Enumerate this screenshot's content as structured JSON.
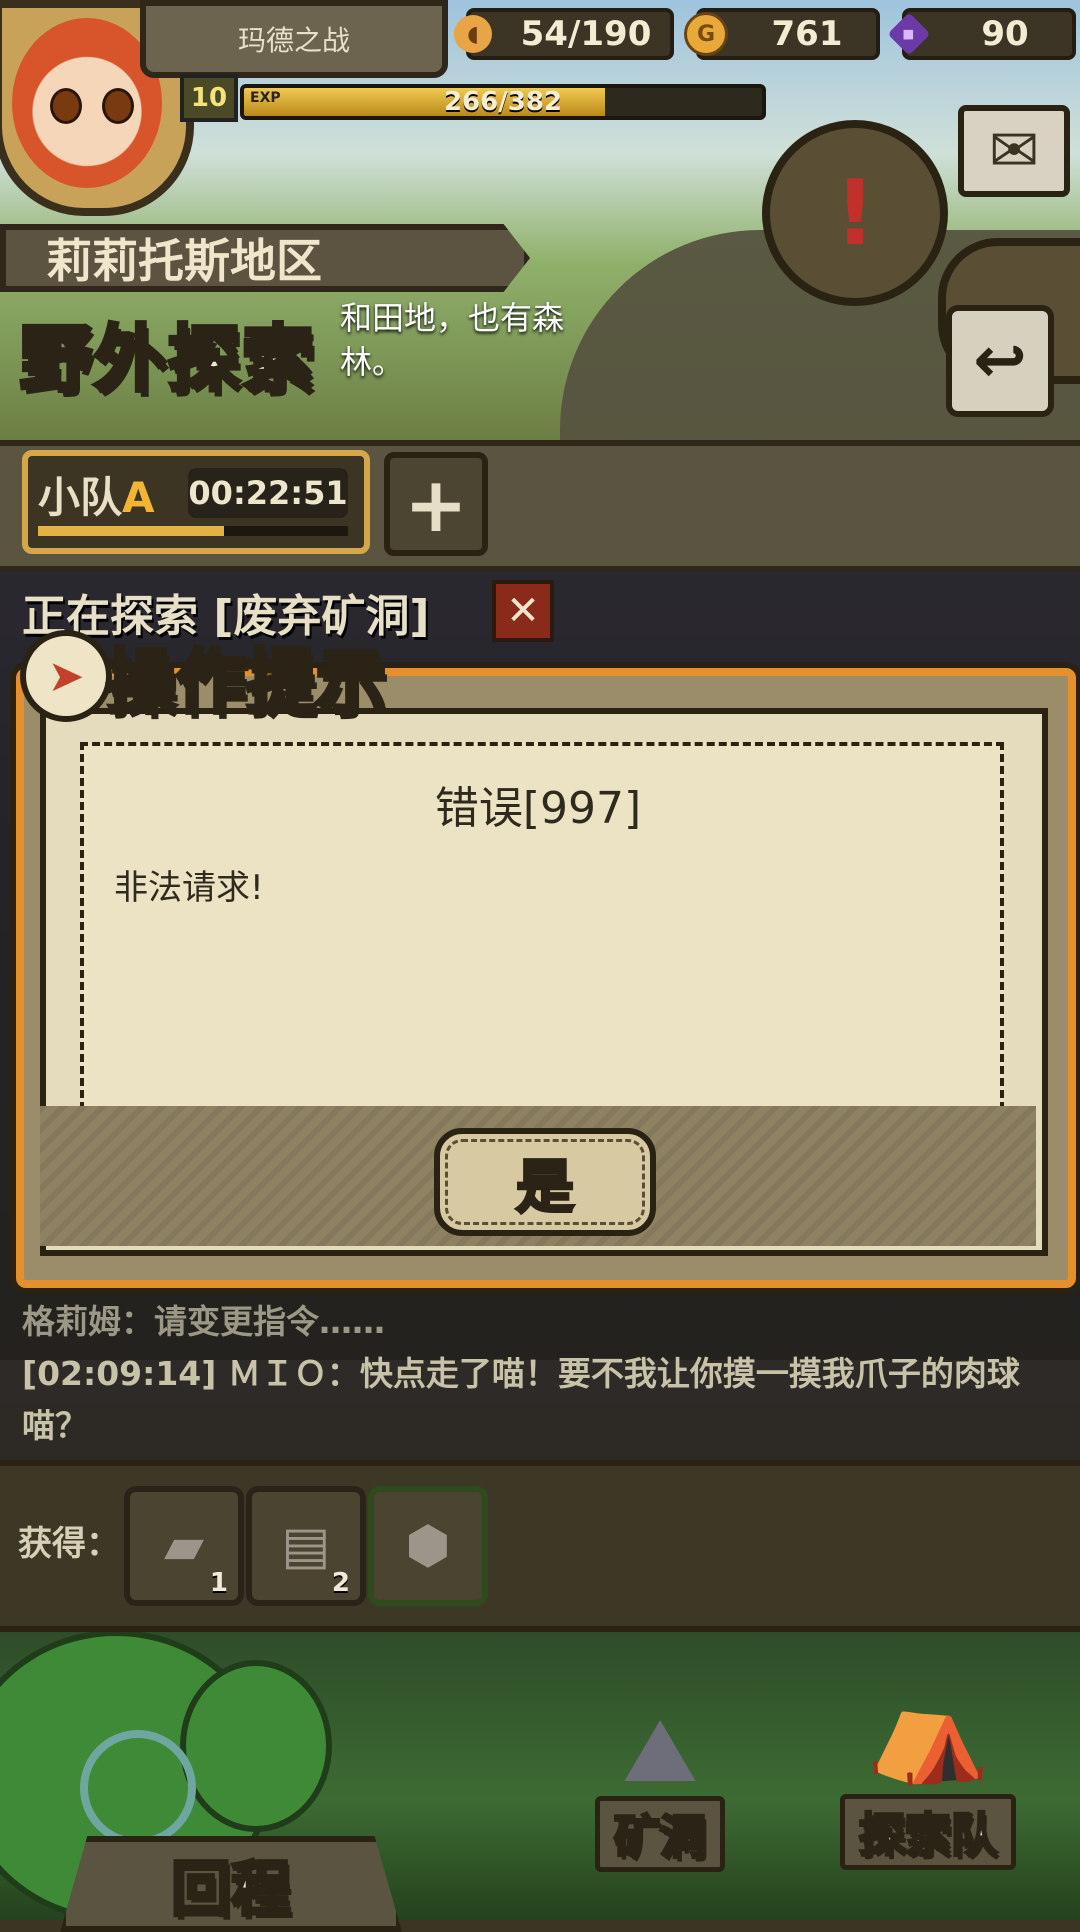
{
  "header": {
    "player_name": "玛德之战",
    "level": "10",
    "exp_tag": "EXP",
    "exp_text": "266/382",
    "exp_progress": 0.696,
    "resources": [
      {
        "name": "bread",
        "icon": "bread-icon",
        "value": "54/190"
      },
      {
        "name": "gold",
        "icon": "gold-coin-icon",
        "value": "761"
      },
      {
        "name": "gem",
        "icon": "purple-gem-icon",
        "value": "90"
      }
    ]
  },
  "area": {
    "region": "莉莉托斯地区",
    "mode_title": "野外探索",
    "description": "和田地，也有森林。"
  },
  "squad": {
    "name": "小队",
    "letter": "A",
    "timer": "00:22:51",
    "progress": 0.6
  },
  "exploring_text": "正在探索 [废弃矿洞]",
  "dialog": {
    "title": "操作提示",
    "heading": "错误[997]",
    "message": "非法请求!",
    "confirm_label": "是"
  },
  "log": {
    "line1": "格莉姆：请变更指令……",
    "line2": "[02:09:14] ＭＩＯ：快点走了喵！要不我让你摸一摸我爪子的肉球喵？"
  },
  "rewards": {
    "label": "获得：",
    "items": [
      {
        "icon": "stone-tablet-icon",
        "count": "1"
      },
      {
        "icon": "treasure-chest-icon",
        "count": "2"
      },
      {
        "icon": "ore-rock-icon",
        "count": ""
      }
    ]
  },
  "nav": {
    "return_label": "回程",
    "mine_label": "矿洞",
    "team_label": "探索队"
  },
  "colors": {
    "accent_orange": "#e58f2d",
    "gold_text": "#f3b431",
    "panel_dark": "#2a2314"
  }
}
